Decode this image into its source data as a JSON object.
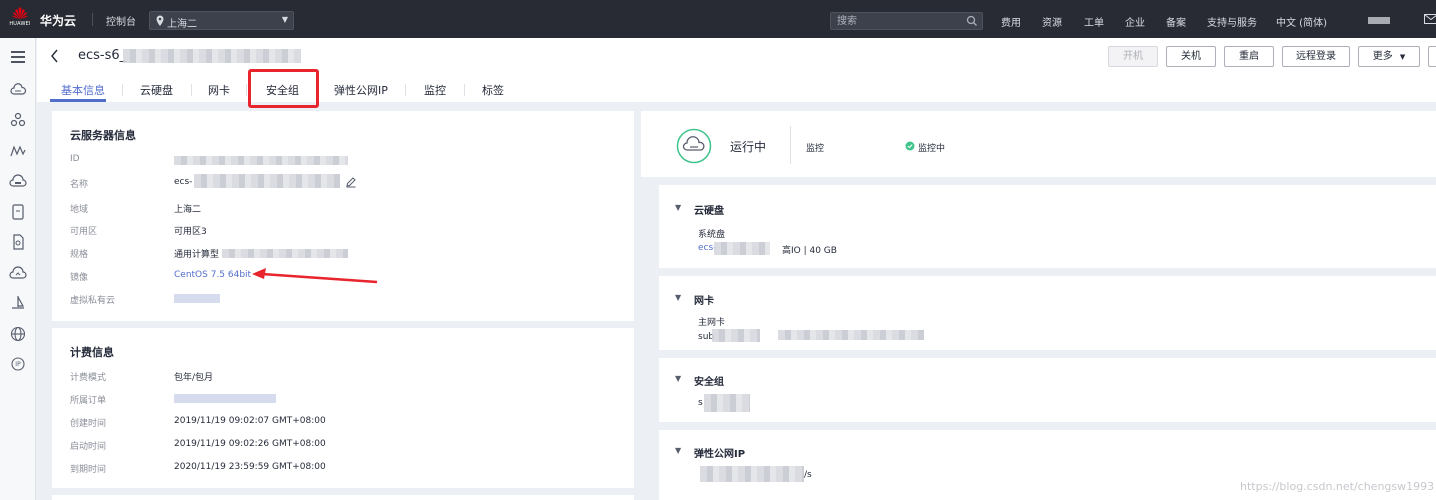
{
  "topbar": {
    "logo_text": "HUAWEI",
    "brand": "华为云",
    "console": "控制台",
    "region": "上海二",
    "search_placeholder": "搜索",
    "nav": [
      "费用",
      "资源",
      "工单",
      "企业",
      "备案",
      "支持与服务",
      "中文 (简体)"
    ]
  },
  "header": {
    "title": "ecs-s6_",
    "buttons": {
      "start": "开机",
      "shutdown": "关机",
      "restart": "重启",
      "remote": "远程登录",
      "more": "更多"
    },
    "tabs": [
      "基本信息",
      "云硬盘",
      "网卡",
      "安全组",
      "弹性公网IP",
      "监控",
      "标签"
    ]
  },
  "server_info": {
    "title": "云服务器信息",
    "labels": {
      "id": "ID",
      "name": "名称",
      "region": "地域",
      "az": "可用区",
      "spec": "规格",
      "image": "镜像",
      "vpc": "虚拟私有云"
    },
    "values": {
      "name": "ecs-",
      "region": "上海二",
      "az": "可用区3",
      "spec": "通用计算型",
      "image": "CentOS 7.5 64bit"
    }
  },
  "billing": {
    "title": "计费信息",
    "labels": {
      "mode": "计费模式",
      "order": "所属订单",
      "created": "创建时间",
      "started": "启动时间",
      "expires": "到期时间"
    },
    "values": {
      "mode": "包年/包月",
      "created": "2019/11/19 09:02:07 GMT+08:00",
      "started": "2019/11/19 09:02:26 GMT+08:00",
      "expires": "2020/11/19 23:59:59 GMT+08:00"
    }
  },
  "status": {
    "state": "运行中",
    "monitor_label": "监控",
    "monitor_state": "监控中"
  },
  "disk": {
    "title": "云硬盘",
    "sub": "系统盘",
    "name": "ecs-",
    "detail": "高IO | 40 GB"
  },
  "nic": {
    "title": "网卡",
    "sub": "主网卡",
    "name": "sub"
  },
  "secgroup": {
    "title": "安全组",
    "name": "s"
  },
  "eip": {
    "title": "弹性公网IP",
    "unit": "/s"
  },
  "watermark": "https://blog.csdn.net/chengsw1993"
}
